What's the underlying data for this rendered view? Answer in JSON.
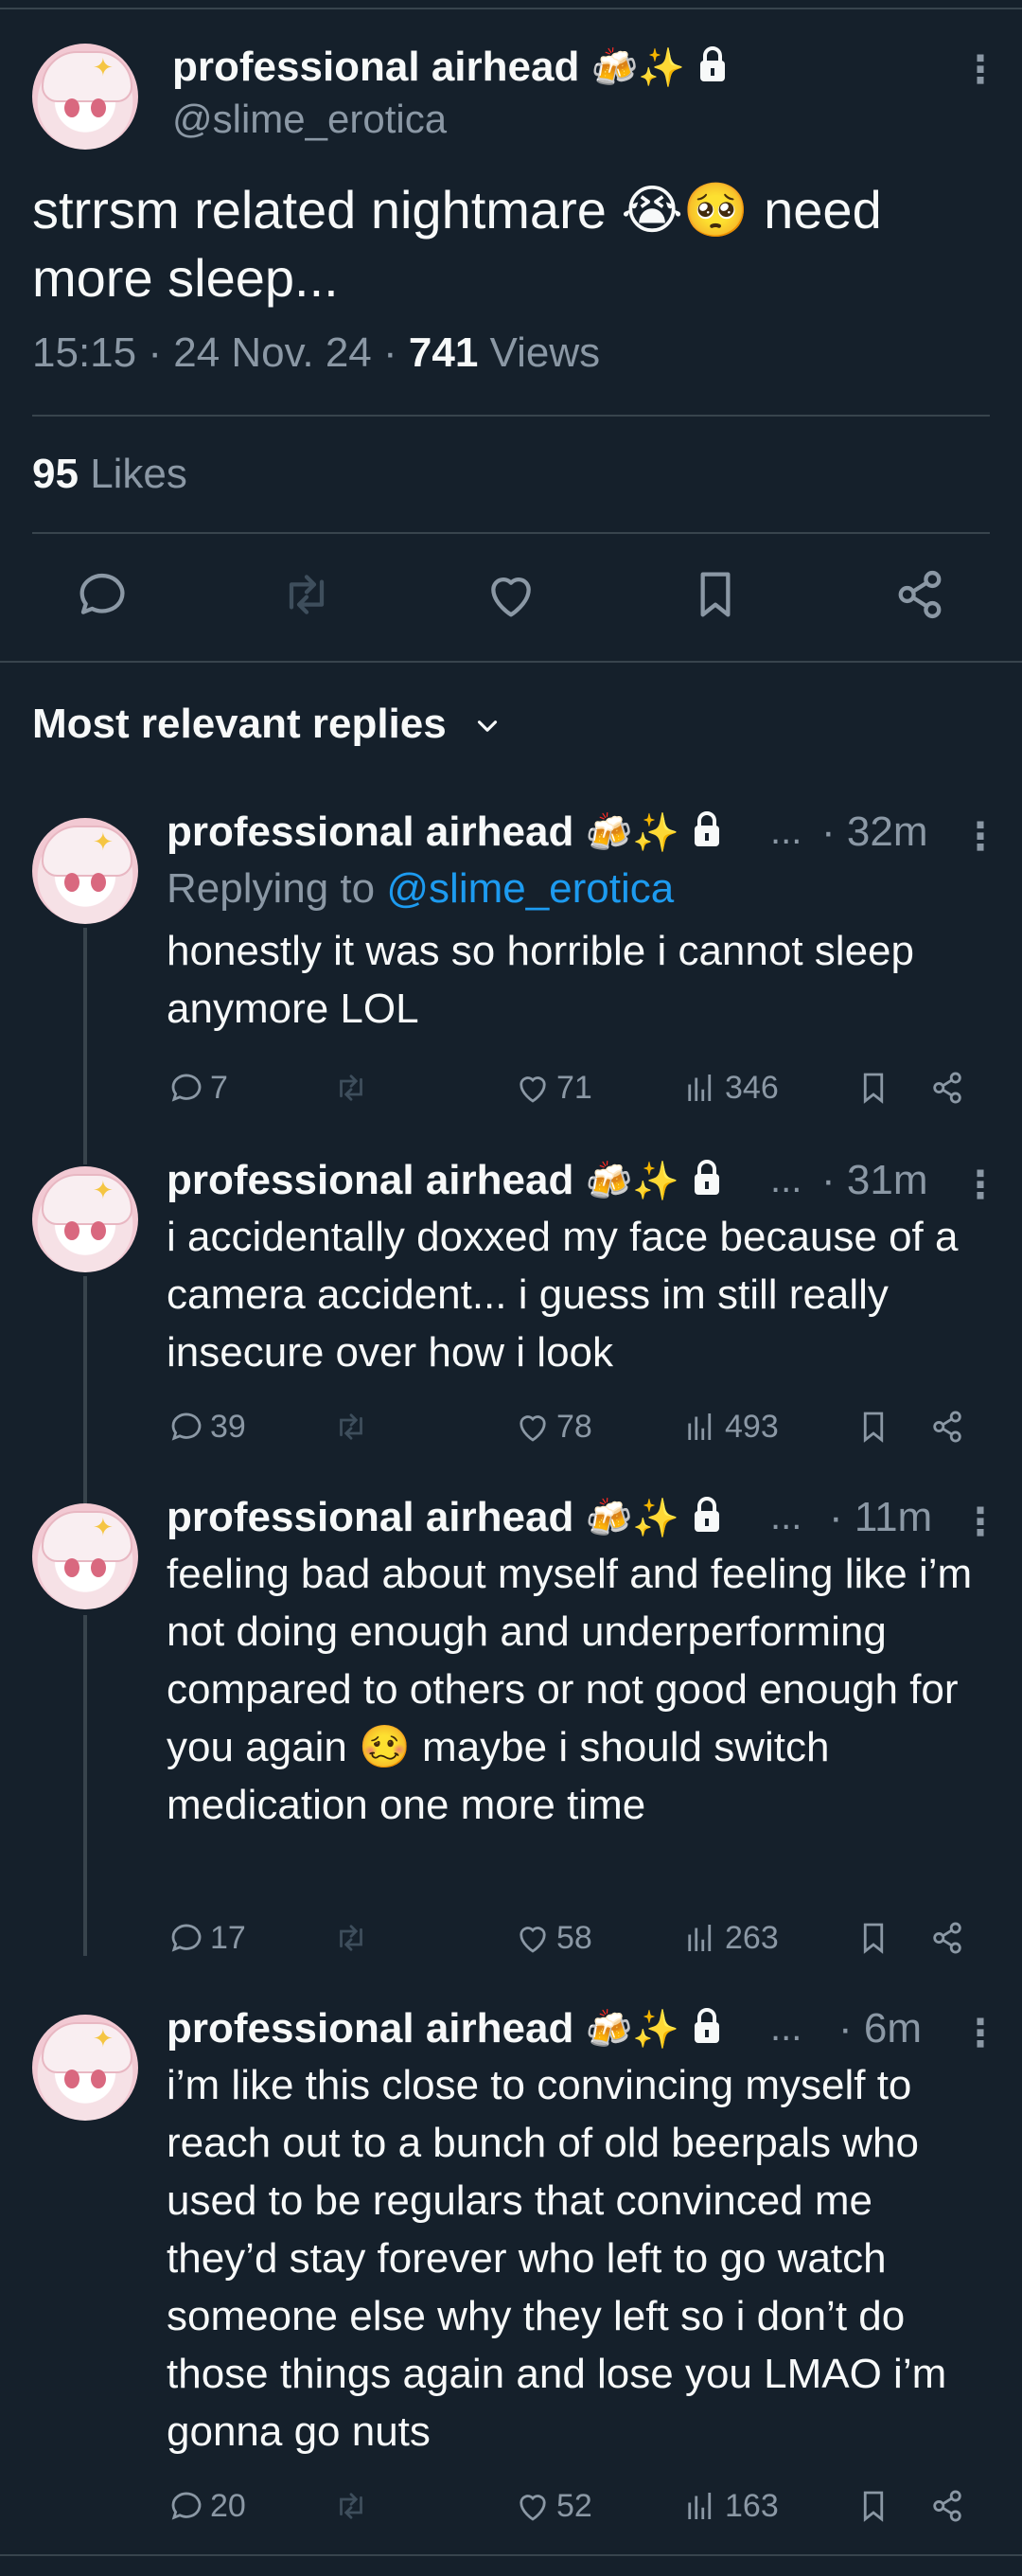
{
  "main_tweet": {
    "display_name": "professional airhead",
    "name_emoji": "🍻✨",
    "handle": "@slime_erotica",
    "text": "strrsm related nightmare 😭🥺 need more sleep...",
    "time": "15:15",
    "date": "24 Nov. 24",
    "views_count": "741",
    "views_label": "Views",
    "likes_count": "95",
    "likes_label": "Likes"
  },
  "sort_label": "Most relevant replies",
  "replies": [
    {
      "display_name": "professional airhead",
      "name_emoji": "🍻✨",
      "ellipsis": "...",
      "time": "· 32m",
      "replying_prefix": "Replying to",
      "replying_handle": "@slime_erotica",
      "text": "honestly it was so horrible i cannot sleep anymore LOL",
      "replies": "7",
      "likes": "71",
      "views": "346"
    },
    {
      "display_name": "professional airhead",
      "name_emoji": "🍻✨",
      "ellipsis": "...",
      "time": "· 31m",
      "text": "i accidentally doxxed my face because of a camera accident... i guess im still really insecure over how i look",
      "replies": "39",
      "likes": "78",
      "views": "493"
    },
    {
      "display_name": "professional airhead",
      "name_emoji": "🍻✨",
      "ellipsis": "...",
      "time": "· 11m",
      "text": "feeling bad about myself and feeling like i’m not doing enough and underperforming compared to others or not good enough for you again 🥴 maybe i should switch medication one more time",
      "replies": "17",
      "likes": "58",
      "views": "263"
    },
    {
      "display_name": "professional airhead",
      "name_emoji": "🍻✨",
      "ellipsis": "...",
      "time": "· 6m",
      "text": "i’m like this close to convincing myself to reach out to a bunch of old beerpals who used to be regulars that convinced me they’d stay forever who left to go watch someone else why they left so i don’t do those things again and lose you LMAO i’m gonna go nuts",
      "replies": "20",
      "likes": "52",
      "views": "163"
    }
  ],
  "colors": {
    "background": "#15202b",
    "muted": "#8b98a5",
    "link": "#1d9bf0",
    "divider": "#38444d"
  },
  "icons": [
    "reply-icon",
    "retweet-icon",
    "like-icon",
    "bookmark-icon",
    "share-icon",
    "views-icon",
    "lock-icon",
    "more-icon",
    "chevron-down-icon"
  ]
}
